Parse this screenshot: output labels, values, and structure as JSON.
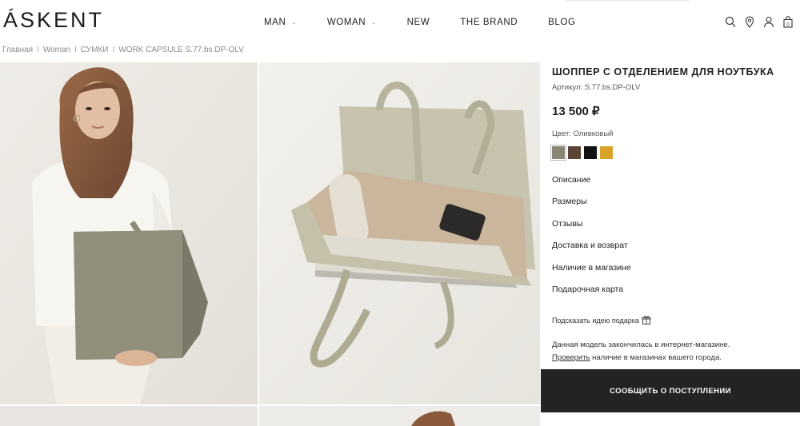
{
  "brand": {
    "logo": "ÁSKENT"
  },
  "nav": {
    "items": [
      {
        "label": "MAN",
        "has_dropdown": true
      },
      {
        "label": "WOMAN",
        "has_dropdown": true
      },
      {
        "label": "NEW",
        "has_dropdown": false
      },
      {
        "label": "THE BRAND",
        "has_dropdown": false
      },
      {
        "label": "BLOG",
        "has_dropdown": false
      }
    ],
    "dropdown_glyph": "⌄"
  },
  "header_icons": [
    "search-icon",
    "location-icon",
    "user-icon",
    "cart-icon"
  ],
  "cart": {
    "count": "0"
  },
  "breadcrumb": {
    "items": [
      "Главная",
      "Woman",
      "СУМКИ",
      "WORK CAPSULE S.77.bs.DP-OLV"
    ],
    "separator": "I"
  },
  "product": {
    "title": "ШОППЕР С ОТДЕЛЕНИЕМ ДЛЯ НОУТБУКА",
    "sku": "Артикул: S.77.bs.DP-OLV",
    "price": "13 500 ₽",
    "color_label": "Цвет: Оливковый",
    "swatches": [
      {
        "name": "olive",
        "color": "#8a8574",
        "selected": true
      },
      {
        "name": "brown",
        "color": "#5b4336",
        "selected": false
      },
      {
        "name": "black",
        "color": "#121212",
        "selected": false
      },
      {
        "name": "mustard",
        "color": "#d9a32a",
        "selected": false
      }
    ],
    "accordion": [
      "Описание",
      "Размеры",
      "Отзывы",
      "Доставка и возврат",
      "Наличие в магазине",
      "Подарочная карта"
    ],
    "gift_hint": "Подсказать идею подарка",
    "notice_line1": "Данная модель закончилась в интернет-магазине.",
    "notice_link": "Проверить",
    "notice_line2_rest": " наличие в магазинах вашего города.",
    "notify_button": "СООБЩИТЬ О ПОСТУПЛЕНИИ"
  },
  "colors": {
    "button_bg": "#232323",
    "text": "#222222",
    "muted": "#8a8a8a"
  }
}
